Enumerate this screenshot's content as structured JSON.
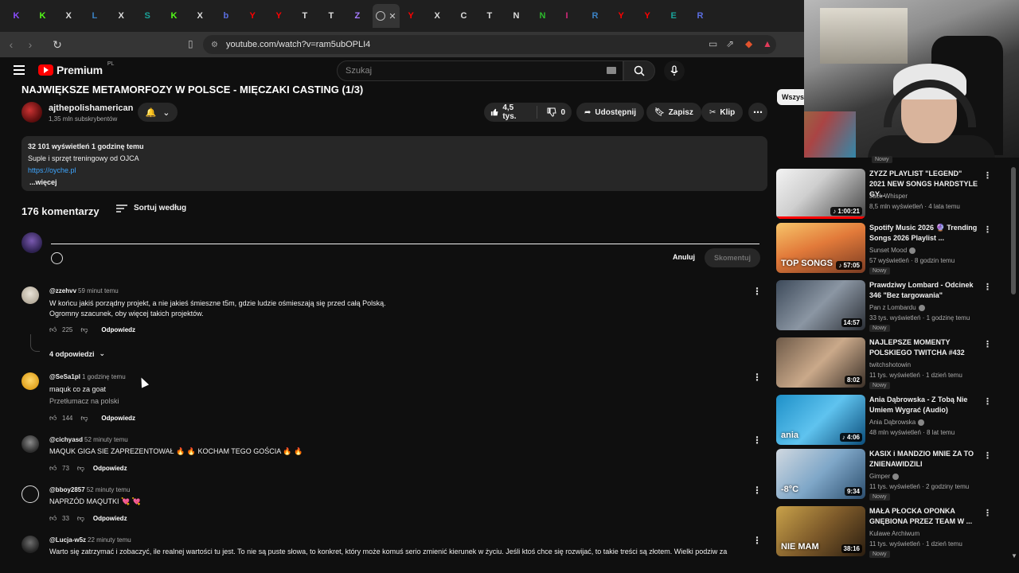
{
  "browser": {
    "tabs": [
      {
        "letter": "K",
        "color": "#8a4dff"
      },
      {
        "letter": "K",
        "color": "#53fc18"
      },
      {
        "letter": "X",
        "color": "#ddd"
      },
      {
        "letter": "L",
        "color": "#3b82c4"
      },
      {
        "letter": "X",
        "color": "#ddd"
      },
      {
        "letter": "S",
        "color": "#1aa39a"
      },
      {
        "letter": "K",
        "color": "#53fc18"
      },
      {
        "letter": "X",
        "color": "#ddd"
      },
      {
        "letter": "b",
        "color": "#5b6ee1"
      },
      {
        "letter": "Y",
        "color": "#ff0000"
      },
      {
        "letter": "Y",
        "color": "#ff0000"
      },
      {
        "letter": "T",
        "color": "#ddd"
      },
      {
        "letter": "T",
        "color": "#ddd"
      },
      {
        "letter": "Z",
        "color": "#a77bff"
      }
    ],
    "active_tab_close": "✕",
    "tabs_right": [
      {
        "letter": "Y",
        "color": "#ff0000"
      },
      {
        "letter": "X",
        "color": "#ddd"
      },
      {
        "letter": "C",
        "color": "#ddd"
      },
      {
        "letter": "T",
        "color": "#ddd"
      },
      {
        "letter": "N",
        "color": "#ddd"
      },
      {
        "letter": "N",
        "color": "#2dbb2d"
      },
      {
        "letter": "I",
        "color": "#d6287b"
      },
      {
        "letter": "R",
        "color": "#3b82c4"
      },
      {
        "letter": "Y",
        "color": "#ff0000"
      },
      {
        "letter": "Y",
        "color": "#ff0000"
      },
      {
        "letter": "E",
        "color": "#1aa39a"
      },
      {
        "letter": "R",
        "color": "#5b6ee1"
      }
    ],
    "url": "youtube.com/watch?v=ram5ubOPLI4"
  },
  "header": {
    "brand": "Premium",
    "country": "PL",
    "search_placeholder": "Szukaj"
  },
  "video": {
    "title": "NAJWIĘKSZE METAMORFOZY W POLSCE - MIĘCZAKI CASTING (1/3)",
    "channel": "ajthepolishamerican",
    "subscribers": "1,35 mln subskrybentów",
    "likes": "4,5 tys.",
    "dislikes": "0",
    "share": "Udostępnij",
    "save": "Zapisz",
    "clip": "Klip"
  },
  "description": {
    "meta": "32 101 wyświetleń  1 godzinę temu",
    "line1": "Suple i sprzęt treningowy od OJCA",
    "link": "https://oyche.pl",
    "more": "...więcej"
  },
  "comments_header": {
    "count": "176 komentarzy",
    "sort": "Sortuj według",
    "cancel": "Anuluj",
    "submit": "Skomentuj"
  },
  "comments": [
    {
      "author": "@zzehvv",
      "time": "59 minut temu",
      "text": "W końcu jakiś porządny projekt, a nie jakieś śmieszne t5m, gdzie ludzie ośmieszają się przed całą Polską.",
      "text2": "Ogromny szacunek, oby więcej takich projektów.",
      "likes": "225",
      "reply": "Odpowiedz",
      "replies": "4 odpowiedzi"
    },
    {
      "author": "@SeSa1pl",
      "time": "1 godzinę temu",
      "text": "maquk co za goat",
      "translate": "Przetłumacz na polski",
      "likes": "144",
      "reply": "Odpowiedz"
    },
    {
      "author": "@cichyasd",
      "time": "52 minuty temu",
      "text": "MAQUK GIGA SIE ZAPREZENTOWAŁ 🔥 🔥 KOCHAM TEGO GOŚCIA 🔥 🔥",
      "likes": "73",
      "reply": "Odpowiedz"
    },
    {
      "author": "@bboy2857",
      "time": "52 minuty temu",
      "text": "NAPRZÓD MAQUTKI 💘 💘",
      "likes": "33",
      "reply": "Odpowiedz"
    },
    {
      "author": "@Lucja-w5z",
      "time": "22 minuty temu",
      "text": "Warto się zatrzymać i zobaczyć, ile realnej wartości tu jest. To nie są puste słowa, to konkret, który może komuś serio zmienić kierunek w życiu. Jeśli ktoś chce się rozwijać, to takie treści są złotem. Wielki podziw za"
    }
  ],
  "sidebar": {
    "chip": "Wszystkie",
    "first_badge": "Nowy",
    "recs": [
      {
        "title": "ZYZZ PLAYLIST \"LEGEND\" 2021 NEW SONGS HARDSTYLE GY...",
        "channel": "Jack Whisper",
        "meta": "8,5 mln wyświetleń · 4 lata temu",
        "duration": "♪ 1:00:21",
        "badge": "",
        "verified": false,
        "thumb": "linear-gradient(135deg,#f3f3f3 0%,#cfcfcf 40%,#444 100%)",
        "thumb_text": ""
      },
      {
        "title": "Spotify Music 2026 🔮 Trending Songs 2026 Playlist ...",
        "channel": "Sunset Mood",
        "meta": "57 wyświetleń · 8 godzin temu",
        "duration": "♪ 57:05",
        "badge": "Nowy",
        "verified": true,
        "thumb": "linear-gradient(160deg,#f7c56a 0%,#e27a3a 45%,#7a3b22 100%)",
        "thumb_text": "TOP SONGS"
      },
      {
        "title": "Prawdziwy Lombard - Odcinek 346 \"Bez targowania\"",
        "channel": "Pan z Lombardu",
        "meta": "33 tys. wyświetleń · 1 godzinę temu",
        "duration": "14:57",
        "badge": "Nowy",
        "verified": true,
        "thumb": "linear-gradient(135deg,#3d4a5a 0%,#8b96a3 50%,#2b2f36 100%)",
        "thumb_text": ""
      },
      {
        "title": "NAJLEPSZE MOMENTY POLSKIEGO TWITCHA #432",
        "channel": "twitchshotowin",
        "meta": "11 tys. wyświetleń · 1 dzień temu",
        "duration": "8:02",
        "badge": "Nowy",
        "verified": false,
        "thumb": "linear-gradient(135deg,#6e5a48 0%,#caa98a 50%,#3b3028 100%)",
        "thumb_text": ""
      },
      {
        "title": "Ania Dąbrowska - Z Tobą Nie Umiem Wygrać (Audio)",
        "channel": "Ania Dąbrowska",
        "meta": "48 mln wyświetleń · 8 lat temu",
        "duration": "♪ 4:06",
        "badge": "",
        "verified": true,
        "thumb": "linear-gradient(135deg,#1e90c8 0%,#5fc3ef 50%,#0b4d7a 100%)",
        "thumb_text": "ania"
      },
      {
        "title": "KASIX i MANDZIO MNIE ZA TO ZNIENAWIDZILI",
        "channel": "Gimper",
        "meta": "11 tys. wyświetleń · 2 godziny temu",
        "duration": "9:34",
        "badge": "Nowy",
        "verified": true,
        "thumb": "linear-gradient(135deg,#d0d8e0 0%,#7fa7c8 50%,#2c4e6e 100%)",
        "thumb_text": "-8°C"
      },
      {
        "title": "MAŁA PŁOCKA OPONKA GNĘBIONA PRZEZ TEAM W ...",
        "channel": "Kulawe Archiwum",
        "meta": "11 tys. wyświetleń · 1 dzień temu",
        "duration": "38:16",
        "badge": "Nowy",
        "verified": false,
        "thumb": "linear-gradient(135deg,#c9a24a 0%,#7d5a2a 50%,#2a1d10 100%)",
        "thumb_text": "NIE MAM"
      }
    ]
  }
}
